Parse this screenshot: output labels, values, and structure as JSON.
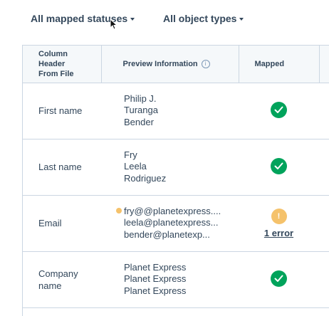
{
  "filters": {
    "status_label": "All mapped statuses",
    "object_label": "All object types"
  },
  "table": {
    "headers": {
      "column_header": "Column Header From File",
      "preview": "Preview Information",
      "mapped": "Mapped"
    },
    "rows": [
      {
        "column": "First name",
        "preview": [
          "Philip J.",
          "Turanga",
          "Bender"
        ],
        "status": "mapped"
      },
      {
        "column": "Last name",
        "preview": [
          "Fry",
          "Leela",
          "Rodriguez"
        ],
        "status": "mapped"
      },
      {
        "column": "Email",
        "preview": [
          "fry@@planetexpress....",
          "leela@planetexpress...",
          "bender@planetexp..."
        ],
        "status": "error",
        "error_label": "1 error",
        "warning_glyph": "!"
      },
      {
        "column": "Company name",
        "preview": [
          "Planet Express",
          "Planet Express",
          "Planet Express"
        ],
        "status": "mapped"
      }
    ]
  },
  "colors": {
    "success": "#00a35b",
    "warning": "#f5c26b",
    "border": "#cbd6e2",
    "header_bg": "#f5f8fa",
    "text": "#33475b"
  },
  "icons": {
    "filter_caret": "caret-down-icon",
    "info": "info-icon",
    "mapped": "check-circle-icon",
    "error": "warning-circle-icon",
    "error_dot": "warning-dot-icon",
    "cursor": "mouse-pointer-icon"
  }
}
